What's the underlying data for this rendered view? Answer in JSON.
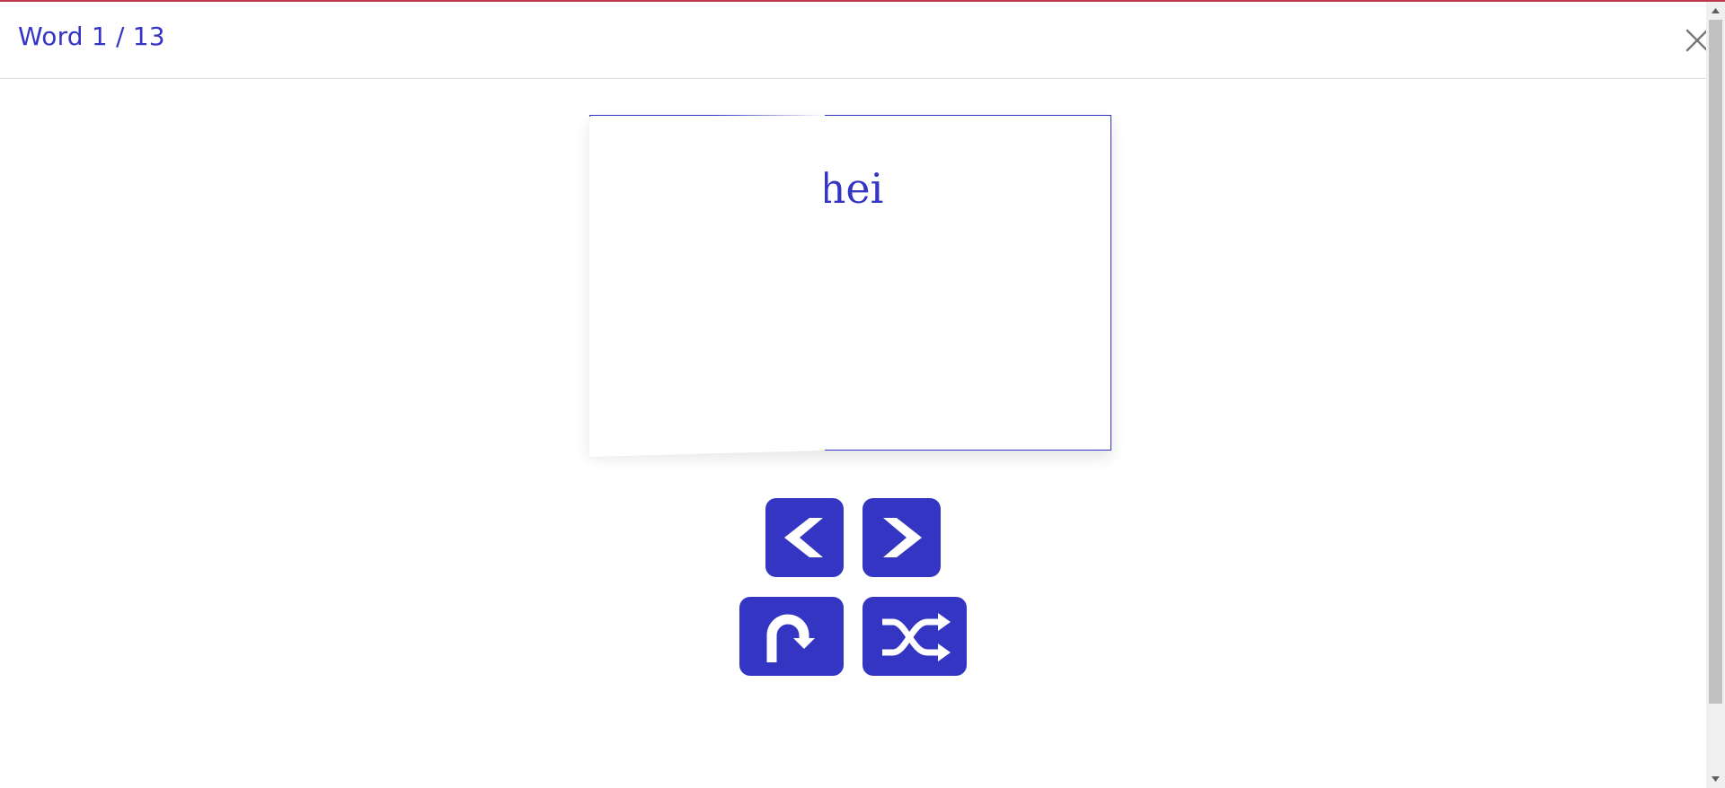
{
  "header": {
    "title": "Word 1 / 13",
    "close_icon": "close-icon"
  },
  "card": {
    "word": "hei"
  },
  "controls": {
    "prev_icon": "chevron-left-icon",
    "next_icon": "chevron-right-icon",
    "flip_icon": "u-turn-arrow-icon",
    "shuffle_icon": "shuffle-icon"
  },
  "colors": {
    "accent": "#3535c4",
    "top_bar": "#c0394b"
  }
}
